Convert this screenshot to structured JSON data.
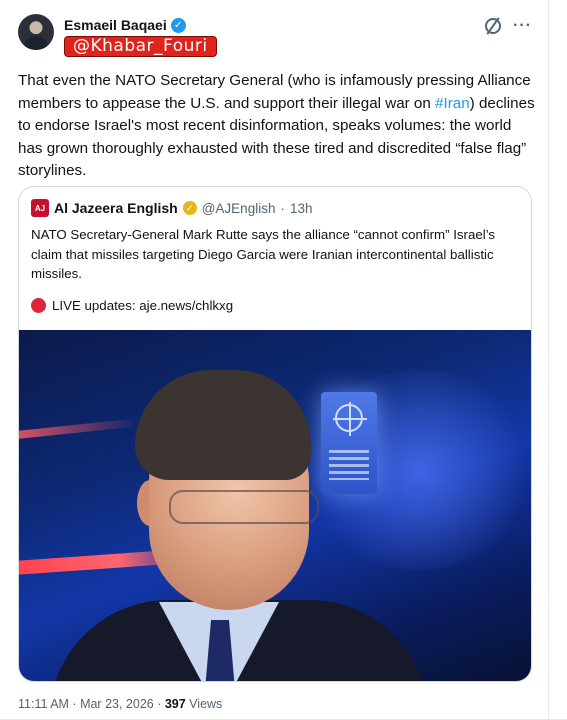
{
  "post": {
    "author": {
      "display_name": "Esmaeil Baqaei",
      "handle_overlay": "@Khabar_Fouri"
    },
    "text_before_hashtag": "That even the NATO Secretary General (who is infamously pressing Alliance members to appease the U.S. and support their illegal war on ",
    "hashtag": "#Iran",
    "text_after_hashtag": ") declines to endorse Israel's most recent disinformation, speaks volumes: the world has grown thoroughly exhausted with these tired and discredited “false flag” storylines.",
    "quoted": {
      "source_name": "Al Jazeera English",
      "logo_text": "AJ",
      "handle": "@AJEnglish",
      "separator": "·",
      "age": "13h",
      "text": "NATO Secretary-General Mark Rutte says the alliance “cannot confirm” Israel’s claim that missiles targeting Diego Garcia were Iranian intercontinental ballistic missiles.",
      "live_text": "LIVE updates: aje.news/chlkxg"
    },
    "time": "11:11 AM · Mar 23, 2026 · ",
    "views_count": "397",
    "views_label": " Views"
  },
  "colors": {
    "accent": "#1d9bf0",
    "overlay_red": "#e0241b",
    "gold_check": "#e2b719",
    "live_dot": "#e0243a"
  },
  "icons": [
    "verified-badge-icon",
    "grok-icon",
    "more-options-icon",
    "gold-verified-icon",
    "live-dot-icon"
  ]
}
